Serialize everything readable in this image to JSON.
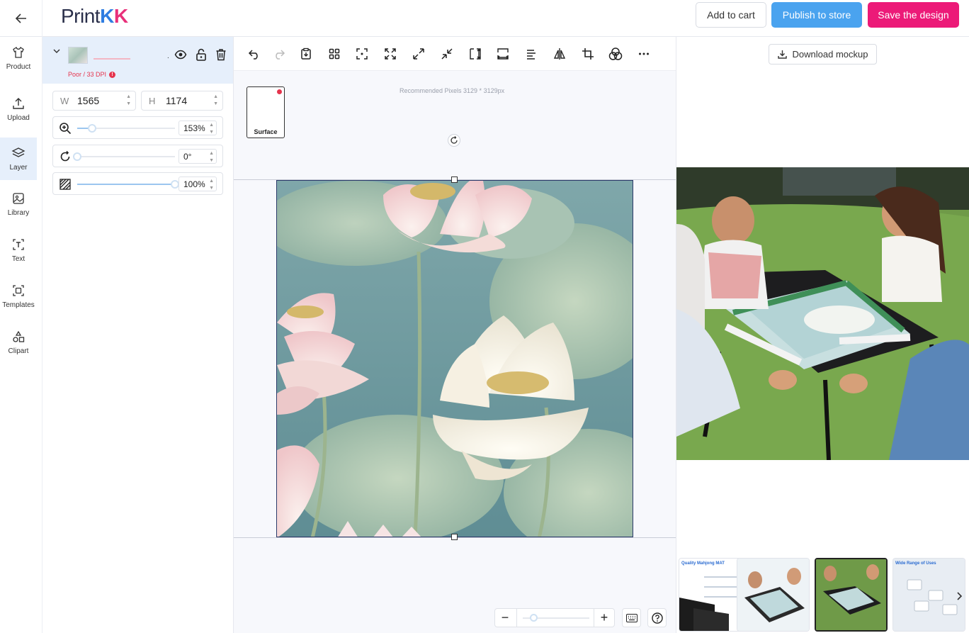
{
  "header": {
    "logo": {
      "part1": "Print",
      "part2": "K",
      "part3": "K"
    },
    "add_to_cart": "Add to cart",
    "publish": "Publish to store",
    "save": "Save the design"
  },
  "leftnav": [
    {
      "label": "Product",
      "icon": "tshirt-icon"
    },
    {
      "label": "Upload",
      "icon": "upload-icon"
    },
    {
      "label": "Layer",
      "icon": "layers-icon",
      "active": true
    },
    {
      "label": "Library",
      "icon": "image-icon"
    },
    {
      "label": "Text",
      "icon": "text-icon"
    },
    {
      "label": "Templates",
      "icon": "templates-icon"
    },
    {
      "label": "Clipart",
      "icon": "shapes-icon"
    }
  ],
  "layer": {
    "quality": "Poor / 33 DPI",
    "dot": ".",
    "width_label": "W",
    "width": "1565",
    "height_label": "H",
    "height": "1174",
    "zoom": "153%",
    "rotation": "0°",
    "opacity": "100%",
    "zoom_level": 0.15,
    "rotation_level": 0.0,
    "opacity_level": 1.0
  },
  "canvas": {
    "surface_label": "Surface",
    "recommended": "Recommended Pixels 3129 * 3129px",
    "zoom_minus": "−",
    "zoom_plus": "+"
  },
  "right": {
    "download": "Download mockup",
    "thumb1_caption": "Quality Mahjong MAT",
    "thumb4_caption": "Wide Range of Uses"
  },
  "colors": {
    "publish": "#4aa3ef",
    "save": "#ec1a78",
    "active_nav": "#e6effb",
    "warning": "#e5344d"
  }
}
